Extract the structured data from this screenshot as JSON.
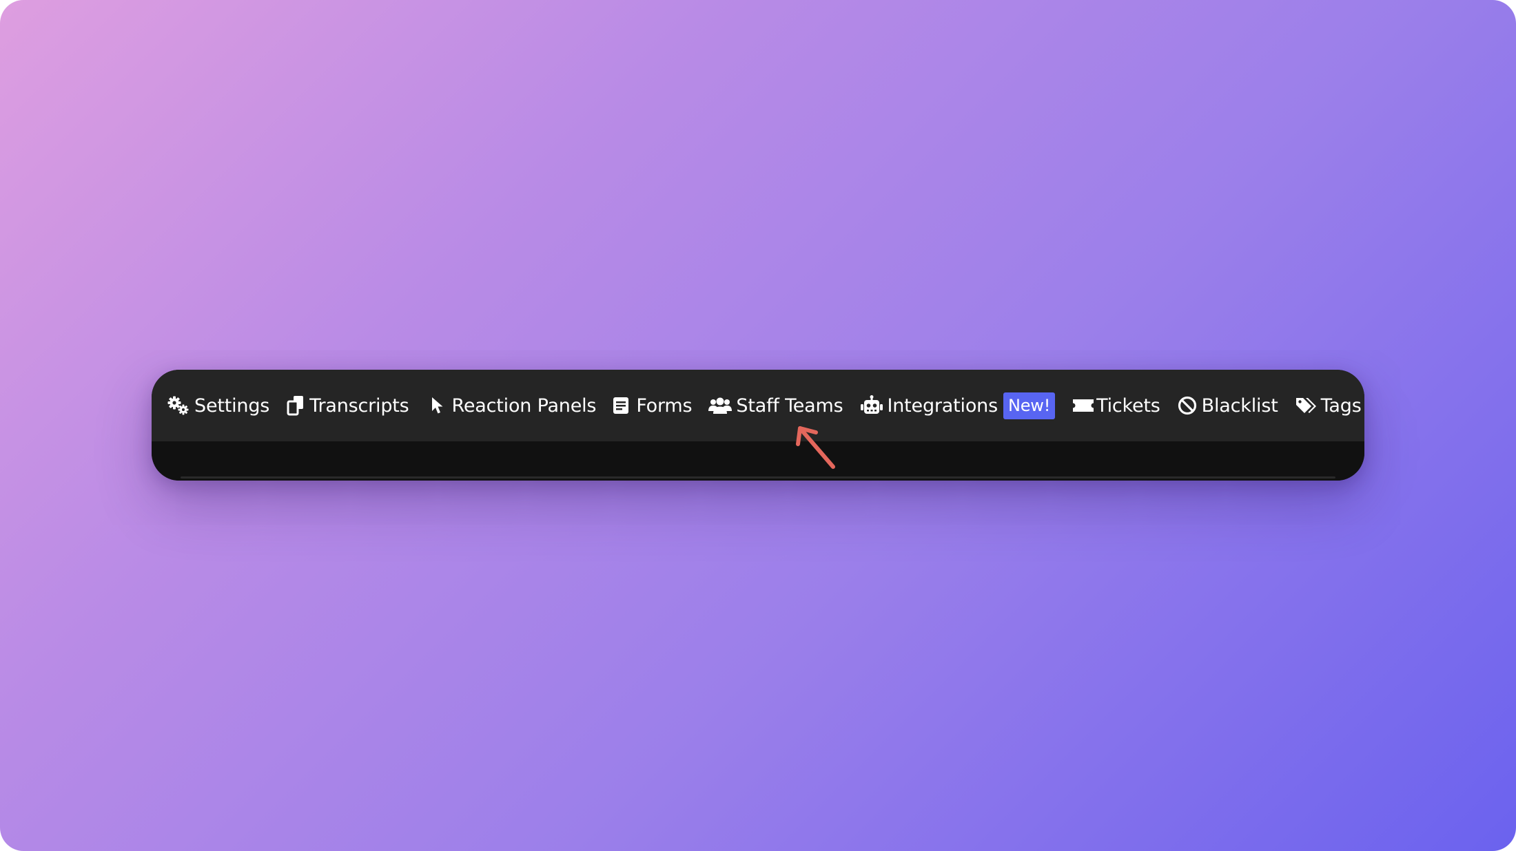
{
  "nav": {
    "items": [
      {
        "label": "Settings",
        "icon": "gears-icon"
      },
      {
        "label": "Transcripts",
        "icon": "copy-icon"
      },
      {
        "label": "Reaction Panels",
        "icon": "pointer-icon"
      },
      {
        "label": "Forms",
        "icon": "form-icon"
      },
      {
        "label": "Staff Teams",
        "icon": "users-icon"
      },
      {
        "label": "Integrations",
        "icon": "robot-icon",
        "badge": "New!"
      },
      {
        "label": "Tickets",
        "icon": "ticket-icon"
      },
      {
        "label": "Blacklist",
        "icon": "ban-icon"
      },
      {
        "label": "Tags",
        "icon": "tags-icon"
      }
    ]
  },
  "colors": {
    "nav_background": "#252525",
    "content_background": "#111111",
    "badge_background": "#5865f2",
    "arrow": "#e4675c"
  }
}
